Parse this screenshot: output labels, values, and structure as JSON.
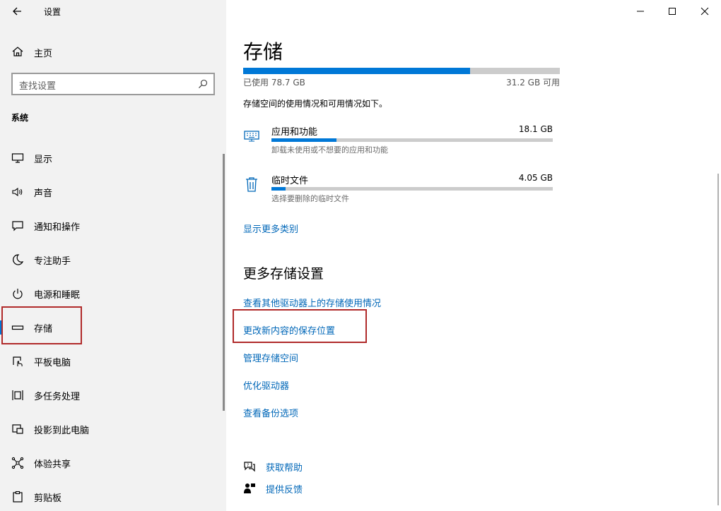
{
  "window": {
    "title": "设置"
  },
  "sidebar": {
    "home_label": "主页",
    "search_placeholder": "查找设置",
    "section_title": "系统",
    "items": [
      {
        "label": "显示",
        "icon": "monitor-icon"
      },
      {
        "label": "声音",
        "icon": "speaker-icon"
      },
      {
        "label": "通知和操作",
        "icon": "notification-icon"
      },
      {
        "label": "专注助手",
        "icon": "moon-icon"
      },
      {
        "label": "电源和睡眠",
        "icon": "power-icon"
      },
      {
        "label": "存储",
        "icon": "storage-icon",
        "selected": true
      },
      {
        "label": "平板电脑",
        "icon": "tablet-icon"
      },
      {
        "label": "多任务处理",
        "icon": "multitask-icon"
      },
      {
        "label": "投影到此电脑",
        "icon": "project-icon"
      },
      {
        "label": "体验共享",
        "icon": "share-icon"
      },
      {
        "label": "剪贴板",
        "icon": "clipboard-icon"
      }
    ]
  },
  "main": {
    "title": "存储",
    "storage": {
      "used_label": "已使用 78.7 GB",
      "free_label": "31.2 GB 可用",
      "used_fraction": 0.716,
      "description": "存储空间的使用情况和可用情况如下。"
    },
    "categories": [
      {
        "name": "应用和功能",
        "size": "18.1 GB",
        "sub": "卸载未使用或不想要的应用和功能",
        "fraction": 0.23,
        "icon": "apps-icon"
      },
      {
        "name": "临时文件",
        "size": "4.05 GB",
        "sub": "选择要删除的临时文件",
        "fraction": 0.05,
        "icon": "trash-icon"
      }
    ],
    "show_more": "显示更多类别",
    "more_heading": "更多存储设置",
    "links": [
      "查看其他驱动器上的存储使用情况",
      "更改新内容的保存位置",
      "管理存储空间",
      "优化驱动器",
      "查看备份选项"
    ],
    "help": {
      "get_help": "获取帮助",
      "feedback": "提供反馈"
    }
  },
  "colors": {
    "accent": "#0078d7",
    "link": "#0067b8",
    "highlight": "#b02a2a"
  }
}
